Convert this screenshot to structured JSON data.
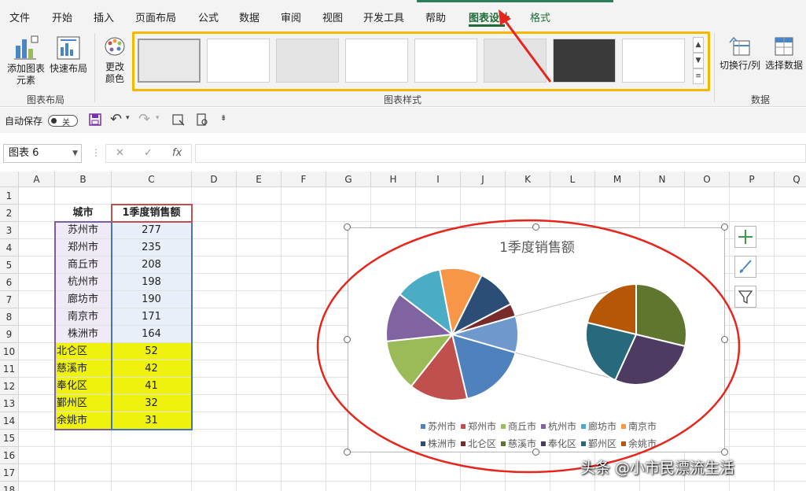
{
  "tabs": [
    "文件",
    "开始",
    "插入",
    "页面布局",
    "公式",
    "数据",
    "审阅",
    "视图",
    "开发工具",
    "帮助",
    "图表设计",
    "格式"
  ],
  "active_tab": "图表设计",
  "ribbon": {
    "add_element": "添加图表",
    "add_element2": "元素",
    "quick_layout": "快速布局",
    "change_colors": "更改",
    "change_colors2": "颜色",
    "group_layout": "图表布局",
    "group_styles": "图表样式",
    "switch_row_col": "切换行/列",
    "select_data": "选择数据",
    "group_data": "数据"
  },
  "qat": {
    "autosave": "自动保存",
    "toggle_state": "关"
  },
  "formula_bar": {
    "name_box": "图表 6",
    "fx": "fx",
    "cancel": "✕",
    "enter": "✓",
    "formula": ""
  },
  "columns": [
    "A",
    "B",
    "C",
    "D",
    "E",
    "F",
    "G",
    "H",
    "I",
    "J",
    "K",
    "L",
    "M",
    "N",
    "O",
    "P",
    "Q"
  ],
  "rows": [
    "1",
    "2",
    "3",
    "4",
    "5",
    "6",
    "7",
    "8",
    "9",
    "10",
    "11",
    "12",
    "13",
    "14",
    "15",
    "16",
    "17",
    "18"
  ],
  "table": {
    "header": [
      "城市",
      "1季度销售额"
    ],
    "cities": [
      "苏州市",
      "郑州市",
      "商丘市",
      "杭州市",
      "廊坊市",
      "南京市",
      "株洲市",
      "北仑区",
      "慈溪市",
      "奉化区",
      "鄞州区",
      "余姚市"
    ],
    "values": [
      "277",
      "235",
      "208",
      "198",
      "190",
      "171",
      "164",
      "52",
      "42",
      "41",
      "32",
      "31"
    ]
  },
  "chart_data": {
    "type": "pie",
    "subtype": "pie-of-pie",
    "title": "1季度销售额",
    "categories": [
      "苏州市",
      "郑州市",
      "商丘市",
      "杭州市",
      "廊坊市",
      "南京市",
      "株洲市",
      "北仑区",
      "慈溪市",
      "奉化区",
      "鄞州区",
      "余姚市"
    ],
    "values": [
      277,
      235,
      208,
      198,
      190,
      171,
      164,
      52,
      42,
      41,
      32,
      31
    ],
    "secondary_plot_count": 4,
    "colors": [
      "#4f81bd",
      "#c0504d",
      "#9bbb59",
      "#8064a2",
      "#4bacc6",
      "#f79646",
      "#2c4d75",
      "#772c2a",
      "#5f7530",
      "#4d3b62",
      "#276a7c",
      "#b65708"
    ],
    "legend_position": "bottom"
  },
  "watermark": "头条 @小市民漂流生活",
  "accent": {
    "ribbon_highlight": "#f5b800",
    "annotation_red": "#e8251c",
    "yellow_fill": "#eef20d",
    "tab_green": "#1e6b38"
  }
}
